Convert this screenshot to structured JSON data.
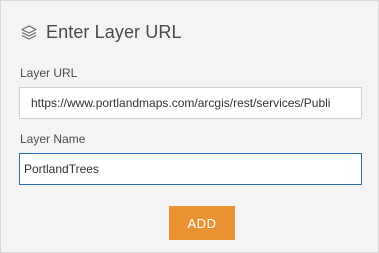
{
  "header": {
    "title": "Enter Layer URL",
    "icon": "layers-icon"
  },
  "form": {
    "url_label": "Layer URL",
    "url_value": "https://www.portlandmaps.com/arcgis/rest/services/Publi",
    "name_label": "Layer Name",
    "name_value": "PortlandTrees"
  },
  "actions": {
    "add_label": "ADD"
  },
  "colors": {
    "accent": "#ea9232",
    "focus": "#2b6fb1",
    "panel_bg": "#f4f4f4"
  }
}
